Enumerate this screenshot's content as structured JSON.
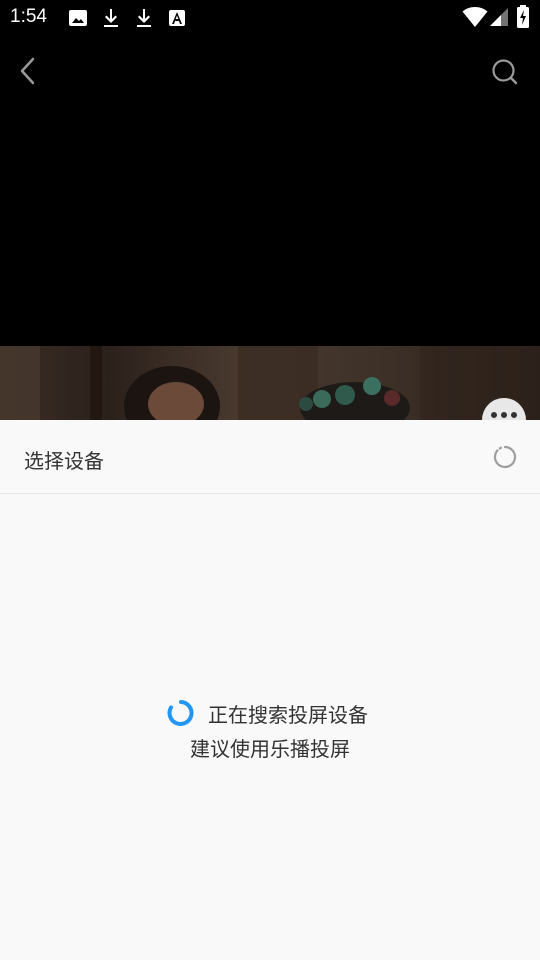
{
  "status_bar": {
    "time": "1:54",
    "icons": [
      "image-icon",
      "download-icon",
      "download-icon",
      "font-a-icon",
      "wifi-icon",
      "signal-icon",
      "battery-charging-icon"
    ]
  },
  "top_bar": {
    "back_icon": "chevron-left-icon",
    "search_icon": "search-icon"
  },
  "sheet": {
    "title": "选择设备",
    "refresh_icon": "refresh-icon",
    "searching_text": "正在搜索投屏设备",
    "suggestion_text": "建议使用乐播投屏"
  },
  "colors": {
    "accent": "#2196F3",
    "sheet_bg": "#F9F9F9",
    "text": "#333333"
  }
}
